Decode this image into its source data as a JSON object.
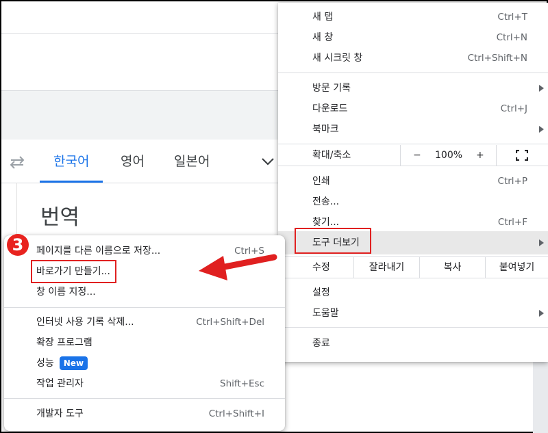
{
  "translate_page": {
    "languages": [
      "한국어",
      "영어",
      "일본어"
    ],
    "heading": "번역"
  },
  "main_menu": {
    "new_tab": {
      "label": "새 탭",
      "shortcut": "Ctrl+T"
    },
    "new_window": {
      "label": "새 창",
      "shortcut": "Ctrl+N"
    },
    "incognito": {
      "label": "새 시크릿 창",
      "shortcut": "Ctrl+Shift+N"
    },
    "history": {
      "label": "방문 기록"
    },
    "downloads": {
      "label": "다운로드",
      "shortcut": "Ctrl+J"
    },
    "bookmarks": {
      "label": "북마크"
    },
    "zoom": {
      "label": "확대/축소",
      "minus": "−",
      "value": "100%",
      "plus": "+"
    },
    "print": {
      "label": "인쇄",
      "shortcut": "Ctrl+P"
    },
    "cast": {
      "label": "전송..."
    },
    "find": {
      "label": "찾기...",
      "shortcut": "Ctrl+F"
    },
    "more_tools": {
      "label": "도구 더보기"
    },
    "edit": {
      "label": "수정",
      "cut": "잘라내기",
      "copy": "복사",
      "paste": "붙여넣기"
    },
    "settings": {
      "label": "설정"
    },
    "help": {
      "label": "도움말"
    },
    "exit": {
      "label": "종료"
    }
  },
  "sub_menu": {
    "save_page": {
      "label": "페이지를 다른 이름으로 저장...",
      "shortcut": "Ctrl+S"
    },
    "create_shortcut": {
      "label": "바로가기 만들기..."
    },
    "name_window": {
      "label": "창 이름 지정..."
    },
    "clear_data": {
      "label": "인터넷 사용 기록 삭제...",
      "shortcut": "Ctrl+Shift+Del"
    },
    "extensions": {
      "label": "확장 프로그램"
    },
    "performance": {
      "label": "성능",
      "badge": "New"
    },
    "task_manager": {
      "label": "작업 관리자",
      "shortcut": "Shift+Esc"
    },
    "dev_tools": {
      "label": "개발자 도구",
      "shortcut": "Ctrl+Shift+I"
    }
  },
  "annotation": {
    "step": "3",
    "color": "#e02020"
  },
  "colors": {
    "accent": "#1a73e8",
    "highlight": "#e8e8e8"
  }
}
